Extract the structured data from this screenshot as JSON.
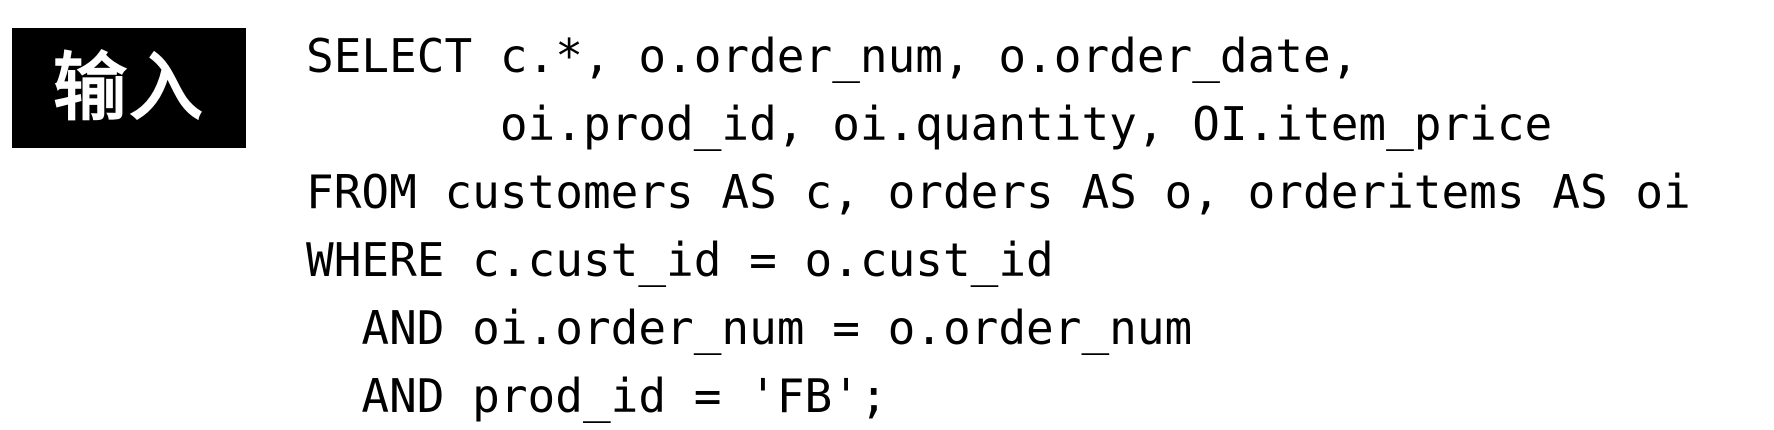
{
  "label": "输入",
  "code_lines": [
    "SELECT c.*, o.order_num, o.order_date,",
    "       oi.prod_id, oi.quantity, OI.item_price",
    "FROM customers AS c, orders AS o, orderitems AS oi",
    "WHERE c.cust_id = o.cust_id",
    "  AND oi.order_num = o.order_num",
    "  AND prod_id = 'FB';"
  ]
}
